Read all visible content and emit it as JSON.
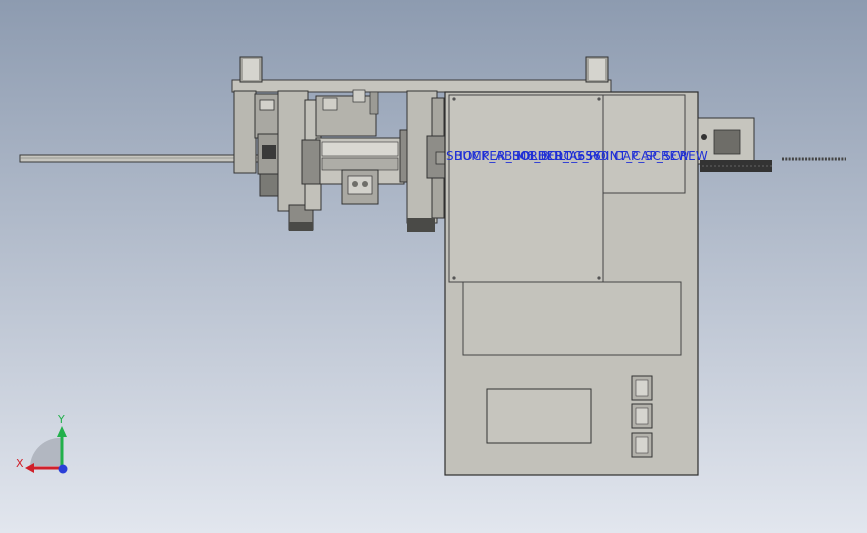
{
  "viewport": {
    "background_top": "#8d9bb0",
    "background_bottom": "#e2e6ee"
  },
  "annotations": {
    "overlapping_labels": [
      "SHOCK_ABSORBER_ASSY",
      "BUMPER_HOLDER",
      "M6_BOLT_6560",
      "DOG_POINT_CAP_SCREW",
      "CAP_SCREW"
    ],
    "color": "#1f2fd6"
  },
  "triad": {
    "x_label": "X",
    "y_label": "Y",
    "x_color": "#d0202a",
    "y_color": "#22b04b",
    "z_color": "#2a3fd8"
  }
}
